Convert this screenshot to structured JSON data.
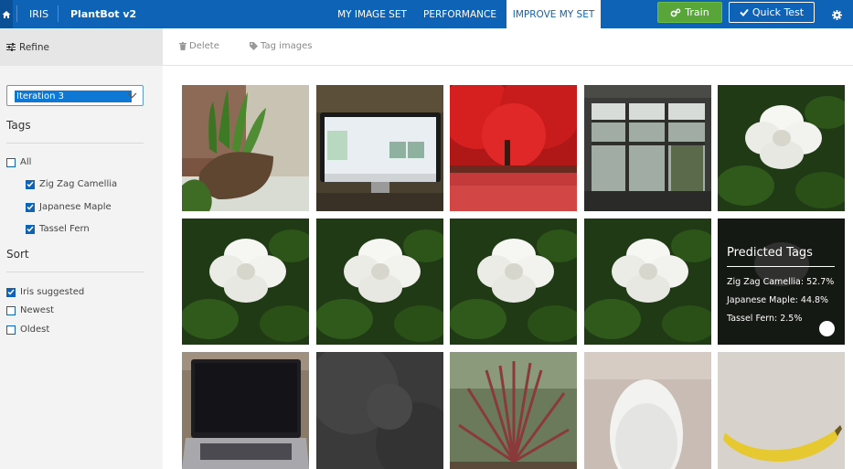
{
  "topbar": {
    "home_icon": "home-icon",
    "app_name": "IRIS",
    "project_name": "PlantBot v2",
    "tabs": [
      {
        "label": "MY IMAGE SET",
        "active": false
      },
      {
        "label": "PERFORMANCE",
        "active": false
      },
      {
        "label": "IMPROVE MY SET",
        "active": true
      }
    ],
    "train_label": "Train",
    "train_icon": "gears-icon",
    "quick_test_label": "Quick Test",
    "quick_test_icon": "check-icon",
    "settings_icon": "gear-icon",
    "colors": {
      "bar": "#0f63b6",
      "train": "#58a53a"
    }
  },
  "sidebar": {
    "refine_label": "Refine",
    "refine_icon": "sliders-icon",
    "iteration_selected": "Iteration 3",
    "tags_title": "Tags",
    "tags": [
      {
        "label": "All",
        "checked": false
      },
      {
        "label": "Zig Zag Camellia",
        "checked": true
      },
      {
        "label": "Japanese Maple",
        "checked": true
      },
      {
        "label": "Tassel Fern",
        "checked": true
      }
    ],
    "sort_title": "Sort",
    "sort_options": [
      {
        "label": "Iris suggested",
        "checked": true
      },
      {
        "label": "Newest",
        "checked": false
      },
      {
        "label": "Oldest",
        "checked": false
      }
    ]
  },
  "toolbar": {
    "delete_label": "Delete",
    "delete_icon": "trash-icon",
    "tag_label": "Tag images",
    "tag_icon": "tag-icon"
  },
  "images": [
    {
      "subject": "green-plant-pot"
    },
    {
      "subject": "computer-monitor"
    },
    {
      "subject": "red-maple-tree"
    },
    {
      "subject": "window"
    },
    {
      "subject": "white-gardenia"
    },
    {
      "subject": "white-gardenia"
    },
    {
      "subject": "white-gardenia"
    },
    {
      "subject": "white-gardenia"
    },
    {
      "subject": "white-gardenia"
    },
    {
      "subject": "predicted-tags-card"
    },
    {
      "subject": "laptop"
    },
    {
      "subject": "dark-texture"
    },
    {
      "subject": "red-plant"
    },
    {
      "subject": "white-mouse"
    },
    {
      "subject": "banana"
    }
  ],
  "prediction": {
    "title": "Predicted Tags",
    "lines": [
      "Zig Zag Camellia: 52.7%",
      "Japanese Maple: 44.8%",
      "Tassel Fern: 2.5%"
    ]
  }
}
